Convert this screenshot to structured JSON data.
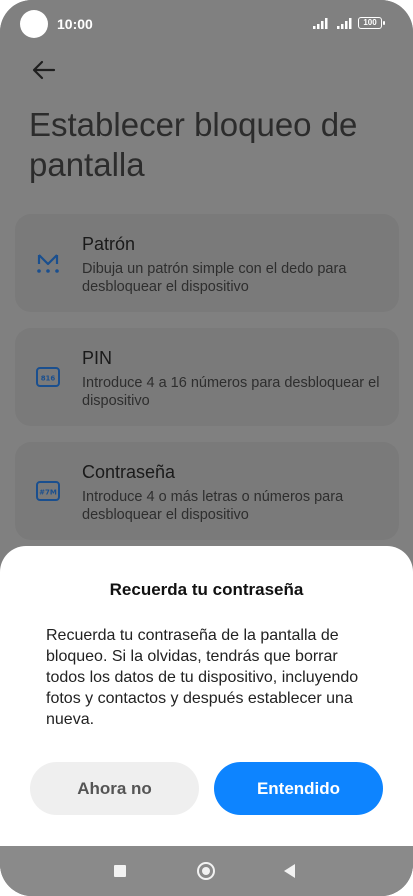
{
  "status_bar": {
    "time": "10:00",
    "battery": "100"
  },
  "header": {
    "title": "Establecer bloqueo de pantalla"
  },
  "options": [
    {
      "title": "Patrón",
      "description": "Dibuja un patrón simple con el dedo para desbloquear el dispositivo",
      "icon": "pattern-icon"
    },
    {
      "title": "PIN",
      "description": "Introduce 4 a 16 números para desbloquear el dispositivo",
      "icon": "pin-icon",
      "icon_text": "816"
    },
    {
      "title": "Contraseña",
      "description": "Introduce 4 o más letras o números para desbloquear el dispositivo",
      "icon": "password-icon",
      "icon_text": "#7M"
    }
  ],
  "dialog": {
    "title": "Recuerda tu contraseña",
    "message": "Recuerda tu contraseña de la pantalla de bloqueo. Si la olvidas, tendrás que borrar todos los datos de tu dispositivo, incluyendo fotos y contactos y después establecer una nueva.",
    "secondary_button": "Ahora no",
    "primary_button": "Entendido"
  },
  "colors": {
    "accent": "#0d84ff",
    "icon_blue": "#1a4f8f",
    "scrim": "#808080"
  }
}
